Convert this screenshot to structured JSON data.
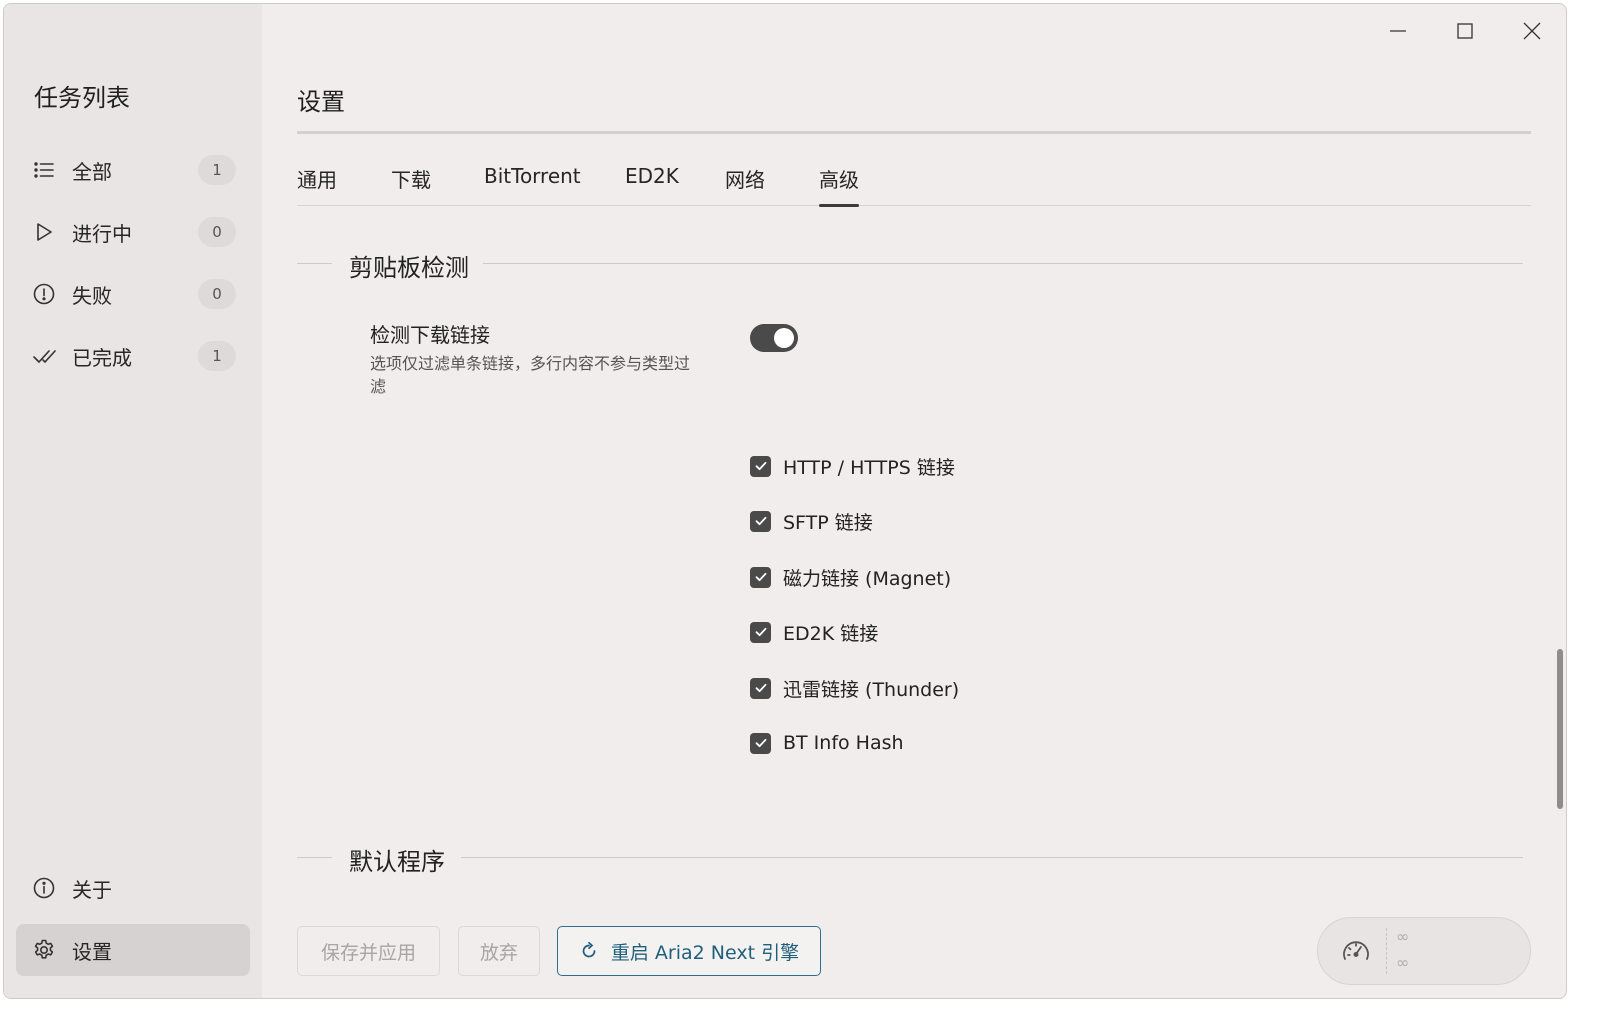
{
  "sidebar": {
    "title": "任务列表",
    "items": [
      {
        "label": "全部",
        "count": "1",
        "icon": "list-icon"
      },
      {
        "label": "进行中",
        "count": "0",
        "icon": "play-icon"
      },
      {
        "label": "失败",
        "count": "0",
        "icon": "alert-circle-icon"
      },
      {
        "label": "已完成",
        "count": "1",
        "icon": "double-check-icon"
      }
    ],
    "bottom_items": [
      {
        "label": "关于",
        "icon": "info-icon"
      },
      {
        "label": "设置",
        "icon": "gear-icon"
      }
    ]
  },
  "page": {
    "title": "设置"
  },
  "tabs": [
    {
      "label": "通用"
    },
    {
      "label": "下载"
    },
    {
      "label": "BitTorrent"
    },
    {
      "label": "ED2K"
    },
    {
      "label": "网络"
    },
    {
      "label": "高级",
      "active": true
    }
  ],
  "sections": {
    "clipboard": {
      "title": "剪贴板检测",
      "option_label": "检测下载链接",
      "option_desc": "选项仅过滤单条链接，多行内容不参与类型过滤",
      "toggle_on": true,
      "checks": [
        {
          "label": "HTTP / HTTPS 链接",
          "checked": true
        },
        {
          "label": "SFTP 链接",
          "checked": true
        },
        {
          "label": "磁力链接 (Magnet)",
          "checked": true
        },
        {
          "label": "ED2K 链接",
          "checked": true
        },
        {
          "label": "迅雷链接 (Thunder)",
          "checked": true
        },
        {
          "label": "BT Info Hash",
          "checked": true
        }
      ]
    },
    "default_program": {
      "title": "默认程序"
    }
  },
  "footer": {
    "save_label": "保存并应用",
    "discard_label": "放弃",
    "restart_label": "重启 Aria2 Next 引擎",
    "upload_speed": "∞",
    "download_speed": "∞"
  },
  "colors": {
    "accent": "#2e6f8e",
    "toggle_on": "#4a4a4a",
    "window_bg": "#f0edec",
    "sidebar_bg": "#e8e5e4"
  }
}
